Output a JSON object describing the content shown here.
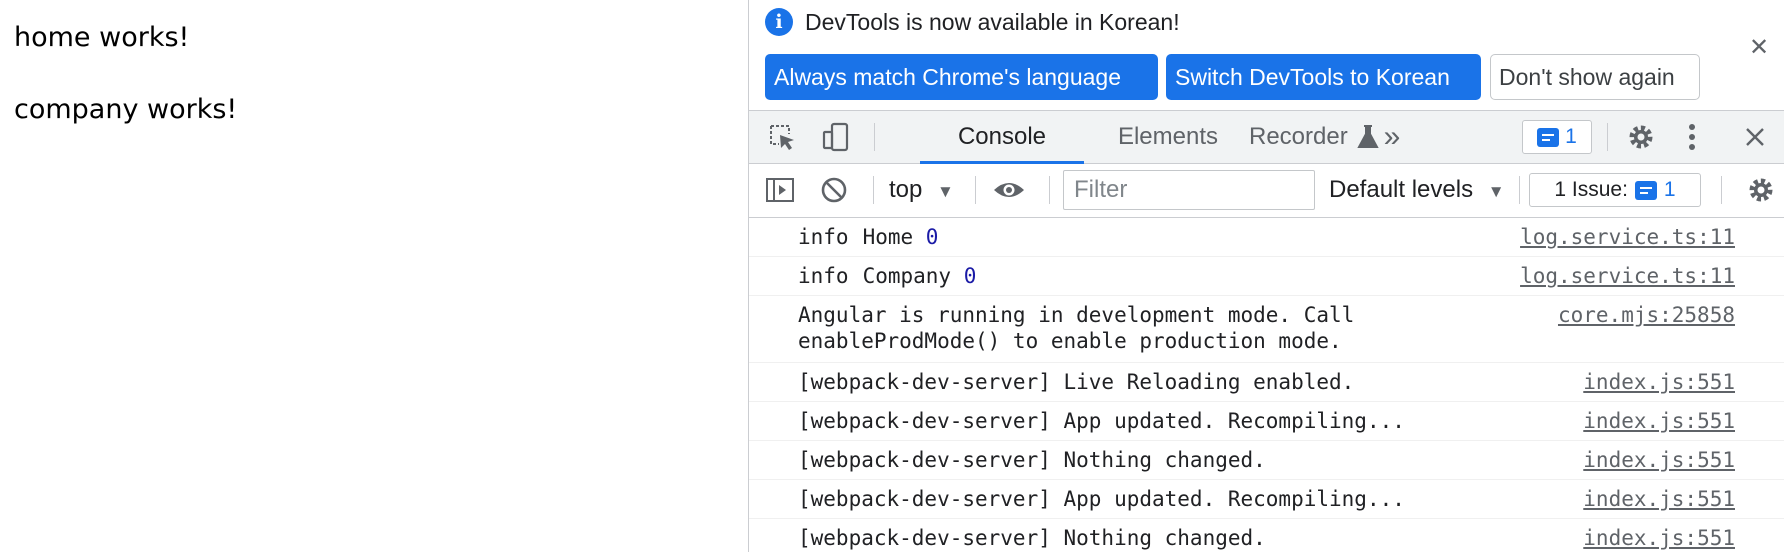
{
  "page": {
    "lines": [
      "home works!",
      "company works!"
    ]
  },
  "infobar": {
    "message": "DevTools is now available in Korean!",
    "info_icon_glyph": "i",
    "buttons": [
      {
        "label": "Always match Chrome's language",
        "style": "primary"
      },
      {
        "label": "Switch DevTools to Korean",
        "style": "primary"
      },
      {
        "label": "Don't show again",
        "style": "secondary"
      }
    ],
    "close_glyph": "✕"
  },
  "main_toolbar": {
    "tabs": [
      {
        "label": "Console",
        "active": true
      },
      {
        "label": "Elements",
        "active": false
      },
      {
        "label": "Recorder",
        "active": false
      }
    ],
    "more_tabs_glyph": "»",
    "issues_count": "1",
    "icons": [
      "inspect-element-icon",
      "device-toolbar-icon",
      "flask-icon",
      "settings-gear-icon",
      "more-vertical-icon",
      "close-devtools-icon"
    ]
  },
  "console_toolbar": {
    "context": "top",
    "dropdown_glyph": "▼",
    "filter_placeholder": "Filter",
    "levels": "Default levels",
    "issue_label": "1 Issue:",
    "issue_count": "1",
    "icons": [
      "sidebar-toggle-icon",
      "clear-console-icon",
      "eye-icon",
      "settings-gear-icon"
    ]
  },
  "console": {
    "rows": [
      {
        "level": "info",
        "text": "Home ",
        "num": "0",
        "source": "log.service.ts:11"
      },
      {
        "level": "info",
        "text": "Company ",
        "num": "0",
        "source": "log.service.ts:11"
      },
      {
        "level": "",
        "text": "Angular is running in development mode. Call\nenableProdMode() to enable production mode.",
        "num": "",
        "source": "core.mjs:25858"
      },
      {
        "level": "",
        "text": "[webpack-dev-server] Live Reloading enabled.",
        "num": "",
        "source": "index.js:551"
      },
      {
        "level": "",
        "text": "[webpack-dev-server] App updated. Recompiling...",
        "num": "",
        "source": "index.js:551"
      },
      {
        "level": "",
        "text": "[webpack-dev-server] Nothing changed.",
        "num": "",
        "source": "index.js:551"
      },
      {
        "level": "",
        "text": "[webpack-dev-server] App updated. Recompiling...",
        "num": "",
        "source": "index.js:551"
      },
      {
        "level": "",
        "text": "[webpack-dev-server] Nothing changed.",
        "num": "",
        "source": "index.js:551"
      }
    ]
  },
  "colors": {
    "accent": "#1a73e8",
    "toolbar_bg": "#f1f3f4",
    "number_blue": "#1a1aa6"
  }
}
